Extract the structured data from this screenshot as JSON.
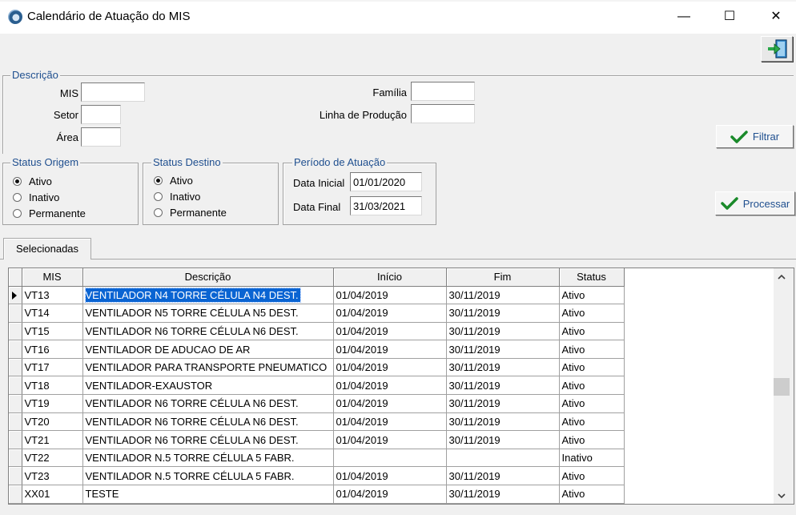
{
  "window": {
    "title": "Calendário de Atuação do MIS",
    "minimize": "—",
    "maximize": "☐",
    "close": "✕"
  },
  "descricao": {
    "legend": "Descrição",
    "mis_label": "MIS",
    "mis_value": "",
    "setor_label": "Setor",
    "setor_value": "",
    "area_label": "Área",
    "area_value": "",
    "familia_label": "Família",
    "familia_value": "",
    "linha_label": "Linha de Produção",
    "linha_value": ""
  },
  "status_origem": {
    "legend": "Status Origem",
    "options": [
      "Ativo",
      "Inativo",
      "Permanente"
    ],
    "selected": "Ativo"
  },
  "status_destino": {
    "legend": "Status Destino",
    "options": [
      "Ativo",
      "Inativo",
      "Permanente"
    ],
    "selected": "Ativo"
  },
  "periodo": {
    "legend": "Período de Atuação",
    "inicial_label": "Data Inicial",
    "inicial_value": "01/01/2020",
    "final_label": "Data Final",
    "final_value": "31/03/2021"
  },
  "buttons": {
    "filtrar": "Filtrar",
    "processar": "Processar"
  },
  "tabs": [
    "Selecionadas"
  ],
  "grid": {
    "columns": [
      "MIS",
      "Descrição",
      "Início",
      "Fim",
      "Status"
    ],
    "rows": [
      [
        "VT13",
        "VENTILADOR N4 TORRE CÉLULA N4 DEST.",
        "01/04/2019",
        "30/11/2019",
        "Ativo"
      ],
      [
        "VT14",
        "VENTILADOR N5 TORRE CÉLULA N5 DEST.",
        "01/04/2019",
        "30/11/2019",
        "Ativo"
      ],
      [
        "VT15",
        "VENTILADOR N6 TORRE CÉLULA N6 DEST.",
        "01/04/2019",
        "30/11/2019",
        "Ativo"
      ],
      [
        "VT16",
        "VENTILADOR DE ADUCAO DE AR",
        "01/04/2019",
        "30/11/2019",
        "Ativo"
      ],
      [
        "VT17",
        "VENTILADOR PARA TRANSPORTE PNEUMATICO",
        "01/04/2019",
        "30/11/2019",
        "Ativo"
      ],
      [
        "VT18",
        "VENTILADOR-EXAUSTOR",
        "01/04/2019",
        "30/11/2019",
        "Ativo"
      ],
      [
        "VT19",
        "VENTILADOR N6 TORRE CÉLULA N6 DEST.",
        "01/04/2019",
        "30/11/2019",
        "Ativo"
      ],
      [
        "VT20",
        "VENTILADOR N6 TORRE CÉLULA N6 DEST.",
        "01/04/2019",
        "30/11/2019",
        "Ativo"
      ],
      [
        "VT21",
        "VENTILADOR N6 TORRE CÉLULA N6 DEST.",
        "01/04/2019",
        "30/11/2019",
        "Ativo"
      ],
      [
        "VT22",
        "VENTILADOR N.5 TORRE CÉLULA 5 FABR.",
        "",
        "",
        "Inativo"
      ],
      [
        "VT23",
        "VENTILADOR N.5 TORRE CÉLULA 5 FABR.",
        "01/04/2019",
        "30/11/2019",
        "Ativo"
      ],
      [
        "XX01",
        "TESTE",
        "01/04/2019",
        "30/11/2019",
        "Ativo"
      ]
    ]
  },
  "icons": {
    "exit": "exit-door-icon",
    "check": "check-icon",
    "scroll_up": "scroll-up-icon",
    "scroll_down": "scroll-down-icon",
    "row_pointer": "current-row-arrow-icon"
  },
  "colors": {
    "accent_text": "#1f4f8f",
    "selection": "#0a64d2",
    "check_green": "#1a8a2a"
  }
}
